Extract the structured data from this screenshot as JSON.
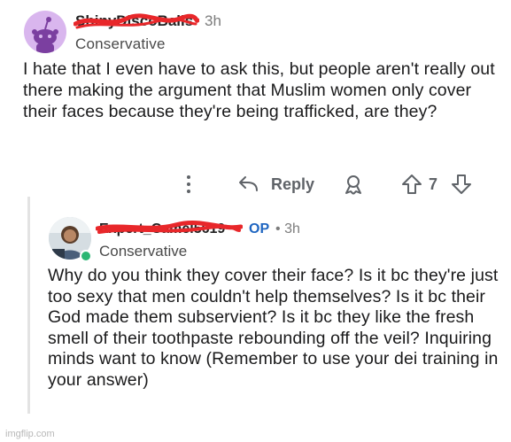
{
  "comment": {
    "username": "ShinyDiscoBalls",
    "time": "3h",
    "flair": "Conservative",
    "body": "I hate that I even have to ask this, but people aren't really out there making the argument that Muslim women only cover their faces because they're being trafficked, are they?",
    "actions": {
      "more_icon": "more-vertical-icon",
      "reply_label": "Reply",
      "award_icon": "award-icon",
      "upvote_icon": "upvote-arrow-icon",
      "vote_count": "7",
      "downvote_icon": "downvote-arrow-icon"
    }
  },
  "reply": {
    "username": "Expert_Camel5619",
    "op_badge": "OP",
    "separator": "•",
    "time": "3h",
    "flair": "Conservative",
    "body": "Why do you think they cover their face? Is it bc they're just too sexy that men couldn't help themselves? Is it bc their God made them subservient? Is it bc they like the fresh smell of their toothpaste rebounding off the veil? Inquiring minds want to know (Remember to use your dei training in your answer)"
  },
  "watermark": "imgflip.com",
  "colors": {
    "redaction": "#e8272a",
    "op_blue": "#1f66c1",
    "online_green": "#2bb673",
    "avatar_bg": "#d9b6ee"
  }
}
